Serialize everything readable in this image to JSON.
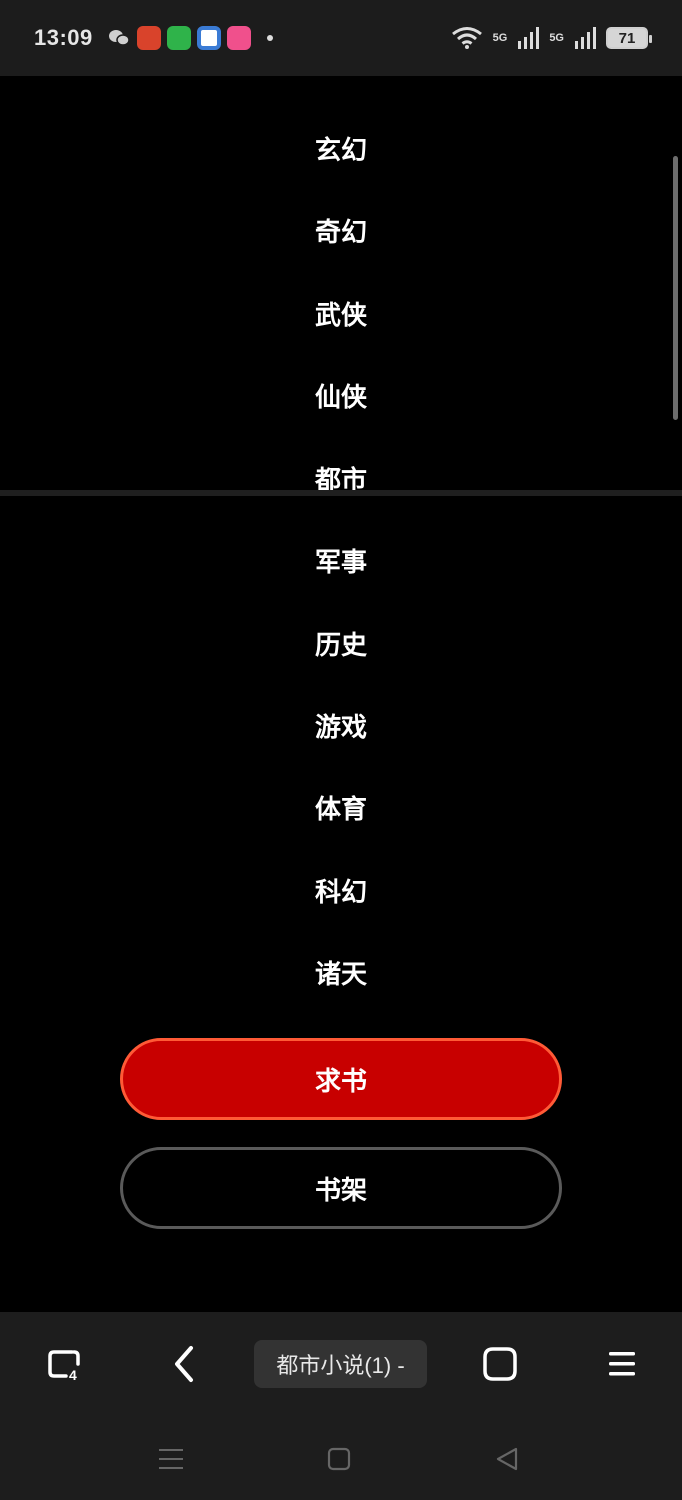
{
  "status_bar": {
    "time": "13:09",
    "notification_icons": [
      {
        "name": "wechat-icon",
        "color": "#cccccc"
      },
      {
        "name": "app-red-icon",
        "color": "#d9432b"
      },
      {
        "name": "app-green-icon",
        "color": "#2fb34a"
      },
      {
        "name": "app-blue-icon",
        "color": "#3a7bd5"
      },
      {
        "name": "app-pink-icon",
        "color": "#f0508c"
      }
    ],
    "network_1": "5G",
    "network_2": "5G",
    "battery": "71"
  },
  "categories": [
    {
      "label": "玄幻"
    },
    {
      "label": "奇幻"
    },
    {
      "label": "武侠"
    },
    {
      "label": "仙侠"
    },
    {
      "label": "都市"
    },
    {
      "label": "军事"
    },
    {
      "label": "历史"
    },
    {
      "label": "游戏"
    },
    {
      "label": "体育"
    },
    {
      "label": "科幻"
    },
    {
      "label": "诸天"
    }
  ],
  "buttons": {
    "request_label": "求书",
    "shelf_label": "书架"
  },
  "browser_bar": {
    "tab_count": "4",
    "page_title": "都市小说(1) -"
  },
  "colors": {
    "accent_red": "#c80000",
    "accent_border": "#ff5a36"
  }
}
